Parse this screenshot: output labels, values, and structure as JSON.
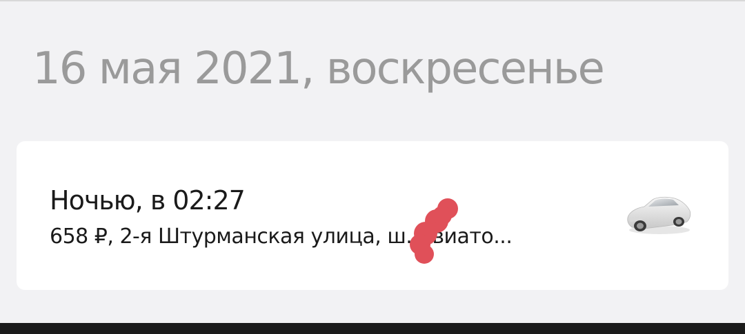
{
  "history": {
    "date_header": "16 мая 2021, воскресенье",
    "rides": [
      {
        "title": "Ночью, в 02:27",
        "details": "658 ₽, 2-я Штурманская улица, ш. Авиато...",
        "icon": "car-icon"
      }
    ]
  },
  "colors": {
    "background": "#f2f2f4",
    "card": "#ffffff",
    "date_text": "#9a9a9a",
    "text": "#1a1a1a",
    "redaction": "#e05059",
    "bottom_bar": "#1b1b1b"
  }
}
